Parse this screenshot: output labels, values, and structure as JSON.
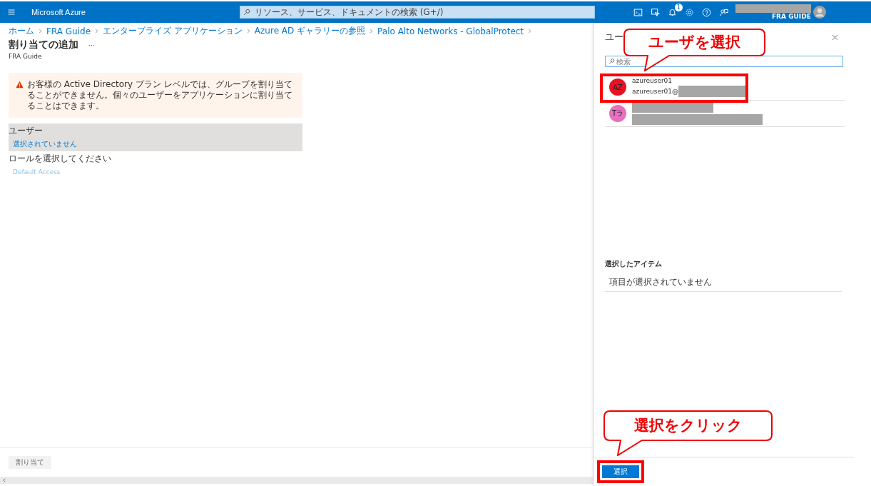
{
  "topbar": {
    "brand": "Microsoft Azure",
    "search_placeholder": "リソース、サービス、ドキュメントの検索 (G+/)",
    "notification_count": "1",
    "account_directory": "FRA GUIDE"
  },
  "breadcrumb": [
    "ホーム",
    "FRA Guide",
    "エンタープライズ アプリケーション",
    "Azure AD ギャラリーの参照",
    "Palo Alto Networks - GlobalProtect"
  ],
  "page": {
    "title": "割り当ての追加",
    "more": "···",
    "subtitle": "FRA Guide",
    "warning": "お客様の Active Directory プラン レベルでは、グループを割り当てることができません。個々のユーザーをアプリケーションに割り当てることはできます。",
    "users_label": "ユーザー",
    "users_value": "選択されていません",
    "role_label": "ロールを選択してください",
    "role_value": "Default Access",
    "assign_button": "割り当て"
  },
  "panel": {
    "title": "ユー",
    "search_placeholder": "検索",
    "users": [
      {
        "initials": "AZ",
        "color": "#e81123",
        "name": "azureuser01",
        "email": "azureuser01@",
        "redacted": false,
        "highlighted": true
      },
      {
        "initials": "Tラ",
        "color": "#e86fbf",
        "redacted": true,
        "highlighted": false
      }
    ],
    "selected_heading": "選択したアイテム",
    "selected_empty": "項目が選択されていません",
    "select_button": "選択"
  },
  "annotations": [
    {
      "kind": "top",
      "text": "ユーザを選択"
    },
    {
      "kind": "bottom",
      "text": "選択をクリック"
    }
  ]
}
